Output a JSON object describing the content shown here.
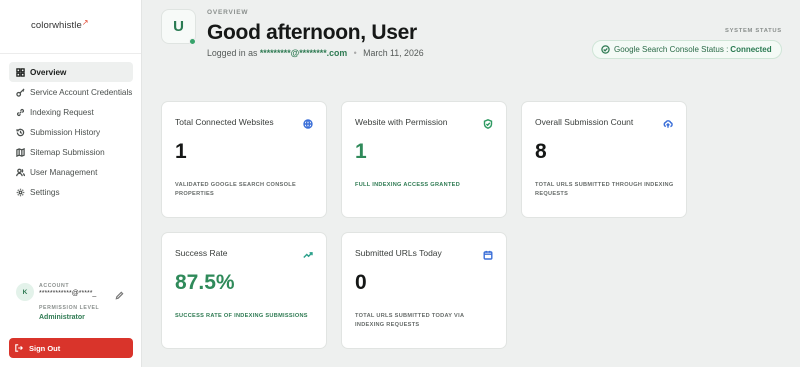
{
  "brand": {
    "logo_text": "colorwhistle",
    "logo_mark": "↗"
  },
  "sidebar": {
    "items": [
      {
        "label": "Overview",
        "icon": "grid-icon",
        "active": true
      },
      {
        "label": "Service Account Credentials",
        "icon": "key-icon",
        "active": false
      },
      {
        "label": "Indexing Request",
        "icon": "link-icon",
        "active": false
      },
      {
        "label": "Submission History",
        "icon": "history-icon",
        "active": false
      },
      {
        "label": "Sitemap Submission",
        "icon": "map-icon",
        "active": false
      },
      {
        "label": "User Management",
        "icon": "users-icon",
        "active": false
      },
      {
        "label": "Settings",
        "icon": "gear-icon",
        "active": false
      }
    ],
    "account": {
      "label": "ACCOUNT",
      "avatar_initial": "K",
      "email": "************@*****_",
      "permission_label": "PERMISSION LEVEL",
      "permission_value": "Administrator"
    },
    "signout_label": "Sign Out"
  },
  "header": {
    "overview_label": "OVERVIEW",
    "avatar_initial": "U",
    "greeting": "Good afternoon, User",
    "logged_in_prefix": "Logged in as",
    "email": "*********@********.com",
    "separator": "•",
    "date": "March 11, 2026"
  },
  "system_status": {
    "label": "SYSTEM STATUS",
    "text": "Google Search Console Status :",
    "state": "Connected"
  },
  "cards": [
    {
      "title": "Total Connected Websites",
      "value": "1",
      "caption": "VALIDATED GOOGLE SEARCH CONSOLE PROPERTIES",
      "icon": "globe-icon",
      "green": false
    },
    {
      "title": "Website with Permission",
      "value": "1",
      "caption": "FULL INDEXING ACCESS GRANTED",
      "icon": "shield-check-icon",
      "green": true
    },
    {
      "title": "Overall Submission Count",
      "value": "8",
      "caption": "TOTAL URLS SUBMITTED THROUGH INDEXING REQUESTS",
      "icon": "upload-cloud-icon",
      "green": false
    },
    {
      "title": "Success Rate",
      "value": "87.5%",
      "caption": "SUCCESS RATE OF INDEXING SUBMISSIONS",
      "icon": "trending-up-icon",
      "green": true
    },
    {
      "title": "Submitted URLs Today",
      "value": "0",
      "caption": "TOTAL URLS SUBMITTED TODAY VIA INDEXING REQUESTS",
      "icon": "calendar-icon",
      "green": false
    }
  ],
  "colors": {
    "accent_green": "#2f8a5a",
    "signout_red": "#d9342b",
    "background": "#eef0ef",
    "card_icon_blue": "#3b6fd8",
    "card_icon_green": "#2f9a62",
    "card_icon_teal": "#2aa08a"
  }
}
